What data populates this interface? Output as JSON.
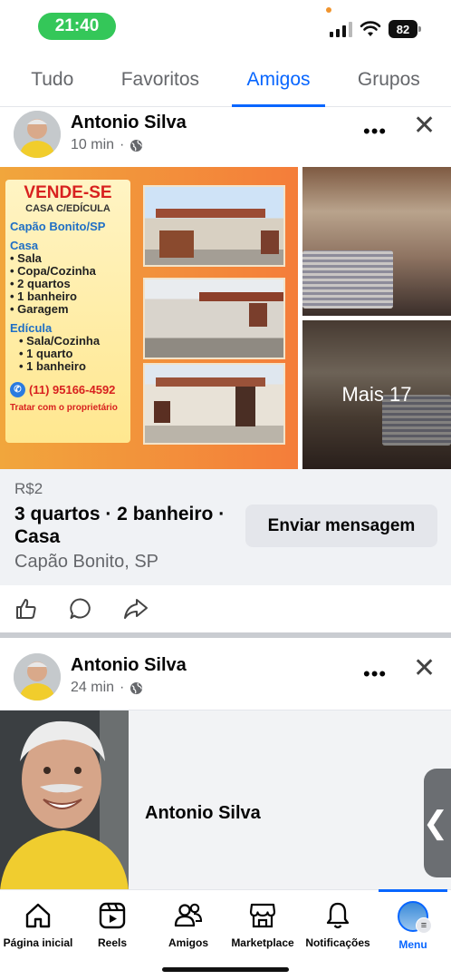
{
  "status": {
    "time": "21:40",
    "battery": "82"
  },
  "tabs": [
    {
      "label": "Tudo",
      "active": false
    },
    {
      "label": "Favoritos",
      "active": false
    },
    {
      "label": "Amigos",
      "active": true
    },
    {
      "label": "Grupos",
      "active": false
    }
  ],
  "post1": {
    "author": "Antonio Silva",
    "time": "10 min",
    "flyer": {
      "headline": "VENDE-SE",
      "subtitle": "CASA C/EDÍCULA",
      "city": "Capão Bonito/SP",
      "casa_title": "Casa",
      "casa_items": [
        "Sala",
        "Copa/Cozinha",
        "2 quartos",
        "1 banheiro",
        "Garagem"
      ],
      "edicula_title": "Edícula",
      "edicula_items": [
        "Sala/Cozinha",
        "1 quarto",
        "1 banheiro"
      ],
      "phone": "(11) 95166-4592",
      "note": "Tratar com o proprietário"
    },
    "more_photos": "Mais 17",
    "listing": {
      "price": "R$2",
      "title": "3 quartos · 2 banheiro · Casa",
      "location": "Capão Bonito, SP",
      "message_button": "Enviar mensagem"
    }
  },
  "post2": {
    "author": "Antonio Silva",
    "time": "24 min",
    "card_name": "Antonio Silva"
  },
  "nav": [
    {
      "label": "Página inicial",
      "icon": "home-icon"
    },
    {
      "label": "Reels",
      "icon": "reels-icon"
    },
    {
      "label": "Amigos",
      "icon": "friends-icon"
    },
    {
      "label": "Marketplace",
      "icon": "marketplace-icon"
    },
    {
      "label": "Notificações",
      "icon": "bell-icon"
    },
    {
      "label": "Menu",
      "icon": "menu-avatar",
      "active": true
    }
  ]
}
